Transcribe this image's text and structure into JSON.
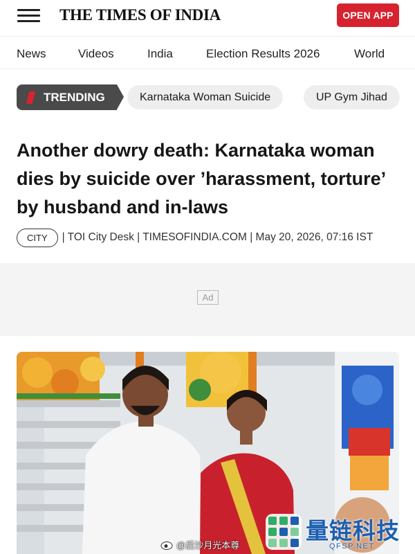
{
  "header": {
    "logo": "THE TIMES OF INDIA",
    "open_app": "OPEN APP"
  },
  "nav": {
    "items": [
      "News",
      "Videos",
      "India",
      "Election Results 2026",
      "World"
    ]
  },
  "trending": {
    "label": "TRENDING",
    "topics": [
      "Karnataka Woman Suicide",
      "UP Gym Jihad"
    ]
  },
  "article": {
    "headline": "Another dowry death: Karnataka woman dies by suicide over ’harassment, torture’ by husband and in-laws",
    "category": "CITY",
    "byline": "| TOI City Desk | TIMESOFINDIA.COM | May 20, 2026, 07:16 IST"
  },
  "ad": {
    "label": "Ad"
  },
  "watermarks": {
    "weibo": "@后沙月光本尊",
    "brand": "量链科技",
    "brand_url": "QFSP.NET"
  },
  "colors": {
    "brand_red": "#d6232f",
    "trending_bg": "#4a4a4a",
    "pill_bg": "#eeeeee",
    "watermark_blue": "#1c5fb0"
  },
  "icons": {
    "menu": "hamburger-menu-icon",
    "trending": "trending-flame-icon",
    "weibo": "weibo-icon",
    "brand": "brand-logo-icon"
  }
}
